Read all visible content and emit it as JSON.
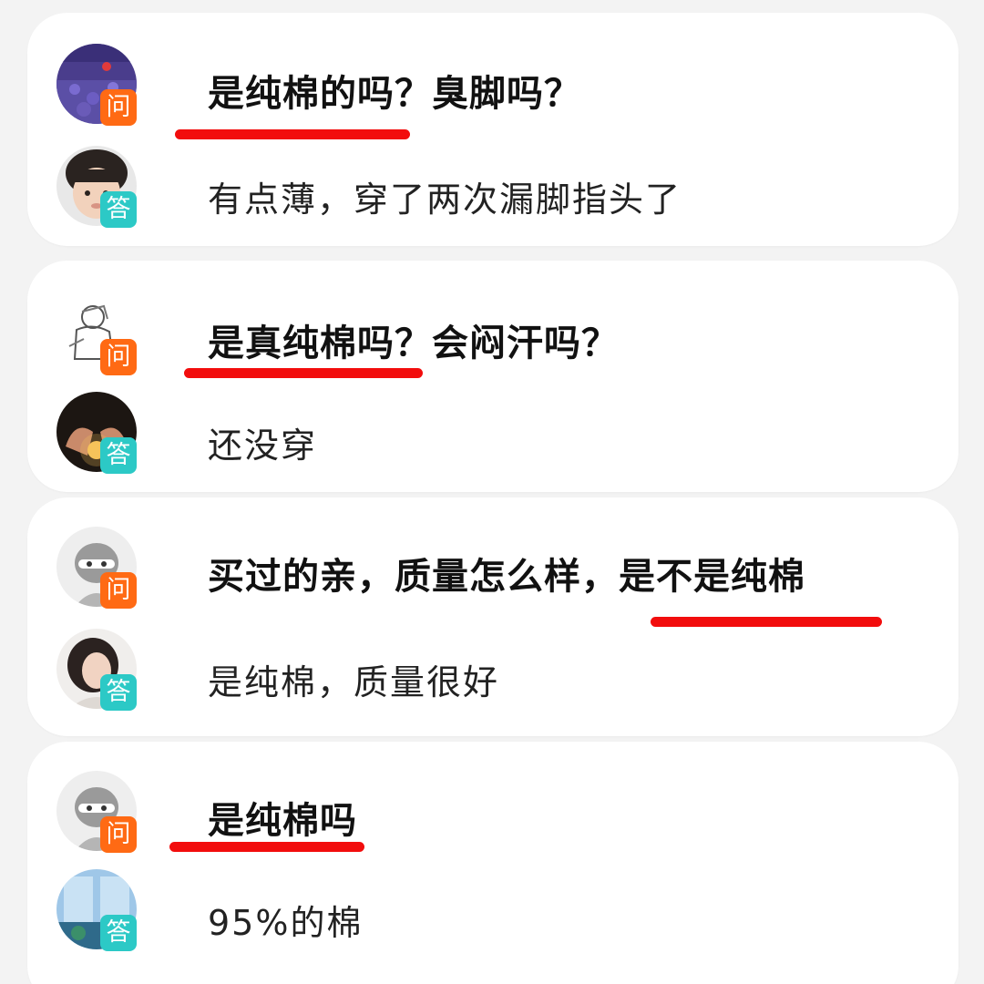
{
  "colors": {
    "ask_tag": "#ff6a14",
    "answer_tag": "#2cc9c6",
    "highlight_underline": "#f20d0d",
    "card_bg": "#ffffff",
    "page_bg": "#f3f3f3"
  },
  "qa_items": [
    {
      "question": {
        "tag": "问",
        "text": "是纯棉的吗？臭脚吗？",
        "avatar": "lavender-field-avatar"
      },
      "answer": {
        "tag": "答",
        "text": "有点薄，穿了两次漏脚指头了",
        "avatar": "child-portrait-avatar"
      }
    },
    {
      "question": {
        "tag": "问",
        "text": "是真纯棉吗？会闷汗吗？",
        "avatar": "sketch-figure-avatar"
      },
      "answer": {
        "tag": "答",
        "text": "还没穿",
        "avatar": "hands-light-avatar"
      }
    },
    {
      "question": {
        "tag": "问",
        "text": "买过的亲，质量怎么样，是不是纯棉",
        "avatar": "default-anonymous-avatar"
      },
      "answer": {
        "tag": "答",
        "text": "是纯棉，质量很好",
        "avatar": "woman-portrait-avatar"
      }
    },
    {
      "question": {
        "tag": "问",
        "text": "是纯棉吗",
        "avatar": "default-anonymous-avatar"
      },
      "answer": {
        "tag": "答",
        "text": "95%的棉",
        "avatar": "window-scene-avatar"
      }
    }
  ]
}
